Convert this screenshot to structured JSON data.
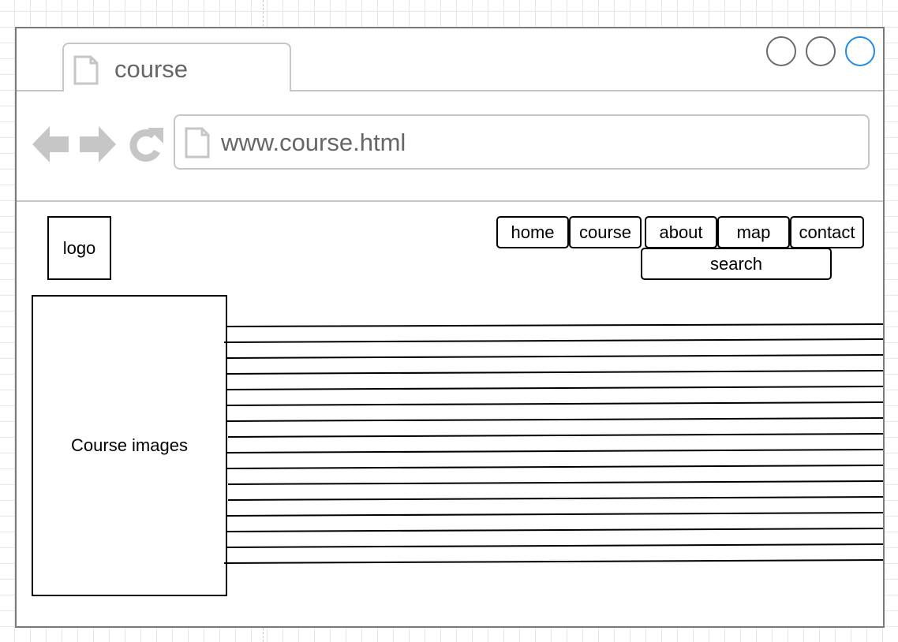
{
  "browser": {
    "tab_title": "course",
    "address_bar_url": "www.course.html",
    "nav_icons": [
      "back-arrow-icon",
      "forward-arrow-icon",
      "refresh-icon"
    ],
    "window_controls": [
      "window-button-icon",
      "window-button-icon",
      "window-button-icon"
    ],
    "active_control_color": "#1e8ce6"
  },
  "page": {
    "logo_label": "logo",
    "nav": {
      "home": "home",
      "course": "course",
      "about": "about",
      "map": "map",
      "contact": "contact",
      "search": "search"
    },
    "image_placeholder": "Course images"
  }
}
